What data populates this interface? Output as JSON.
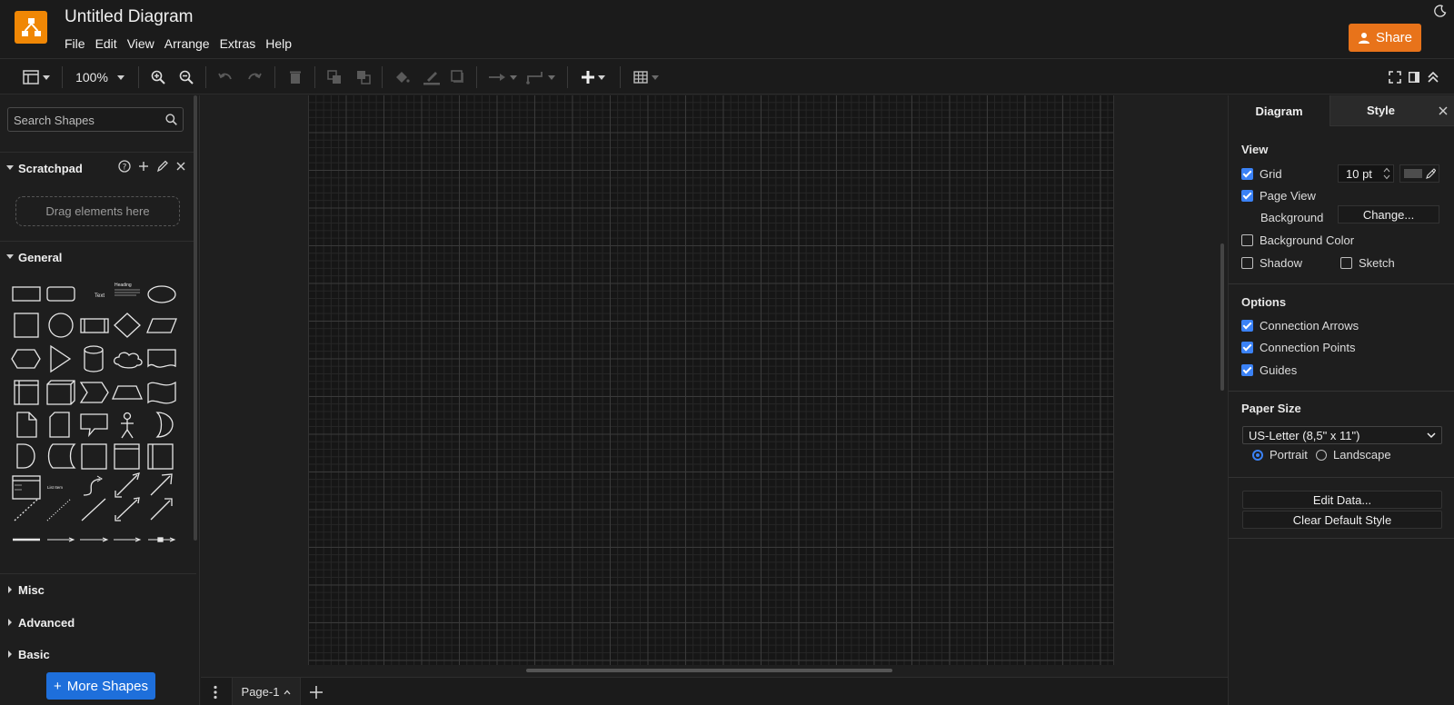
{
  "app": {
    "title": "Untitled Diagram",
    "menu": [
      "File",
      "Edit",
      "View",
      "Arrange",
      "Extras",
      "Help"
    ],
    "share_label": "Share",
    "accent_color": "#e8731a",
    "logo_color": "#f08705"
  },
  "toolbar": {
    "zoom": "100%",
    "icons": [
      "format-panel-icon",
      "zoom-in-icon",
      "zoom-out-icon",
      "undo-icon",
      "redo-icon",
      "delete-icon",
      "to-front-icon",
      "to-back-icon",
      "fill-color-icon",
      "line-color-icon",
      "shadow-icon",
      "connection-icon",
      "waypoints-icon",
      "insert-icon",
      "table-icon",
      "fullscreen-icon",
      "format-toggle-icon",
      "collapse-icon"
    ]
  },
  "sidebar": {
    "search_placeholder": "Search Shapes",
    "scratchpad_label": "Scratchpad",
    "drop_hint": "Drag elements here",
    "general_label": "General",
    "sections": [
      "Misc",
      "Advanced",
      "Basic"
    ],
    "shape_text_label": "Text",
    "shape_heading_label": "Heading",
    "shape_list_label": "List Item",
    "more_shapes_label": "More Shapes"
  },
  "pages": {
    "current": "Page-1"
  },
  "format_panel": {
    "tabs": [
      "Diagram",
      "Style"
    ],
    "view": {
      "heading": "View",
      "grid_label": "Grid",
      "grid_checked": true,
      "grid_size": "10 pt",
      "page_view_label": "Page View",
      "page_view_checked": true,
      "background_label": "Background",
      "change_label": "Change...",
      "background_color_label": "Background Color",
      "background_color_checked": false,
      "shadow_label": "Shadow",
      "shadow_checked": false,
      "sketch_label": "Sketch",
      "sketch_checked": false
    },
    "options": {
      "heading": "Options",
      "items": [
        {
          "label": "Connection Arrows",
          "checked": true
        },
        {
          "label": "Connection Points",
          "checked": true
        },
        {
          "label": "Guides",
          "checked": true
        }
      ]
    },
    "paper": {
      "heading": "Paper Size",
      "size": "US-Letter (8,5\" x 11\")",
      "portrait_label": "Portrait",
      "landscape_label": "Landscape",
      "orientation": "Portrait"
    },
    "edit_data_label": "Edit Data...",
    "clear_style_label": "Clear Default Style"
  }
}
